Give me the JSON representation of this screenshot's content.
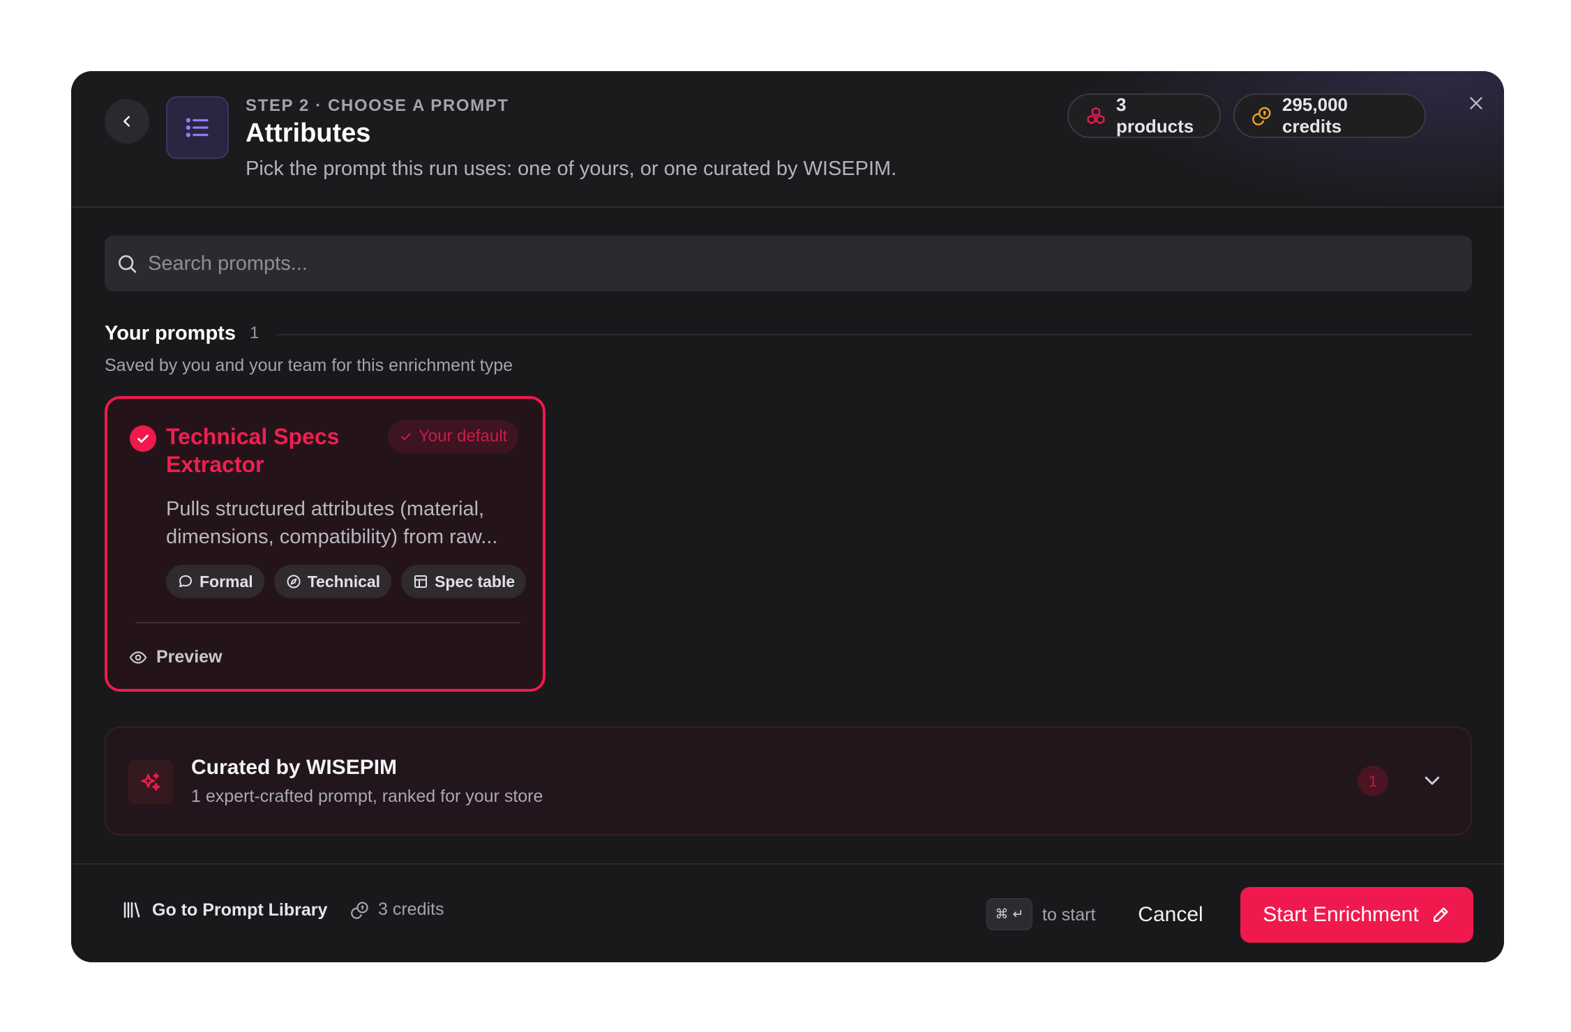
{
  "header": {
    "step_label": "STEP 2 · CHOOSE A PROMPT",
    "title": "Attributes",
    "subtitle": "Pick the prompt this run uses: one of yours, or one curated by WISEPIM.",
    "products_pill": "3 products",
    "credits_pill": "295,000 credits"
  },
  "search": {
    "placeholder": "Search prompts..."
  },
  "your_prompts": {
    "title": "Your prompts",
    "count": "1",
    "subtitle": "Saved by you and your team for this enrichment type",
    "cards": [
      {
        "title": "Technical Specs Extractor",
        "badge": "Your default",
        "description": "Pulls structured attributes (material, dimensions, compatibility) from raw...",
        "tags": [
          "Formal",
          "Technical",
          "Spec table"
        ],
        "preview_label": "Preview",
        "selected": true
      }
    ]
  },
  "curated": {
    "title": "Curated by WISEPIM",
    "subtitle": "1 expert-crafted prompt, ranked for your store",
    "count": "1"
  },
  "footer": {
    "library_link": "Go to Prompt Library",
    "credits": "3 credits",
    "shortcut": "⌘ ↵",
    "shortcut_hint": "to start",
    "cancel": "Cancel",
    "start": "Start Enrichment"
  },
  "colors": {
    "accent": "#f0194e",
    "background": "#19191b",
    "credits_icon": "#f5a524",
    "icon_purple": "#8b7ff0"
  },
  "icons": [
    "chevron-left-icon",
    "list-icon",
    "cubes-icon",
    "coins-icon",
    "close-icon",
    "search-icon",
    "check-icon",
    "chat-bubble-icon",
    "compass-icon",
    "table-icon",
    "eye-icon",
    "sparkles-icon",
    "chevron-down-icon",
    "library-icon",
    "pencil-icon"
  ]
}
